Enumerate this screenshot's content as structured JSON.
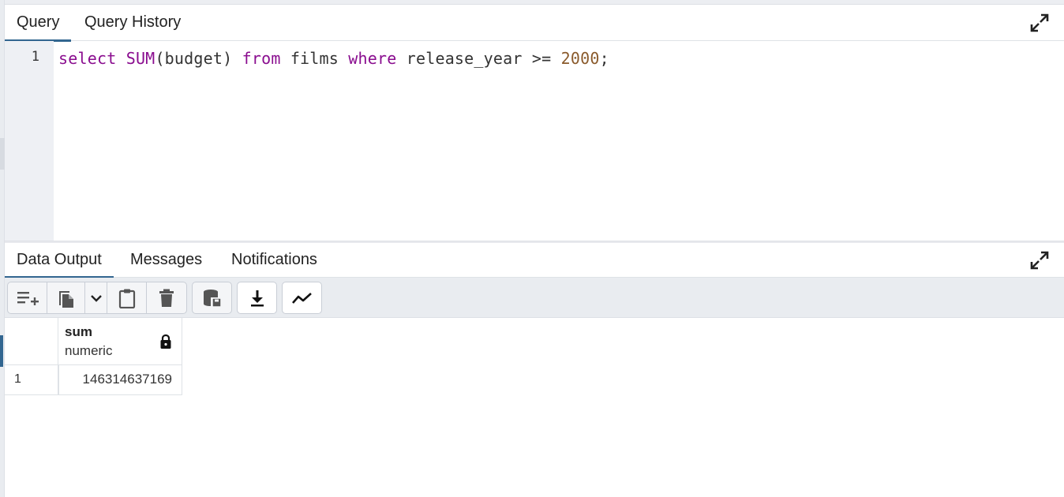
{
  "query_panel": {
    "tabs": [
      {
        "label": "Query",
        "active": true
      },
      {
        "label": "Query History",
        "active": false
      }
    ],
    "editor": {
      "line_number": "1",
      "sql_tokens": {
        "t1": "select",
        "t2": " ",
        "t3": "SUM",
        "t4": "(budget) ",
        "t5": "from",
        "t6": " films ",
        "t7": "where",
        "t8": " release_year >= ",
        "t9": "2000",
        "t10": ";"
      }
    }
  },
  "output_panel": {
    "tabs": [
      {
        "label": "Data Output",
        "active": true
      },
      {
        "label": "Messages",
        "active": false
      },
      {
        "label": "Notifications",
        "active": false
      }
    ],
    "toolbar": {
      "buttons": [
        "add-row-icon",
        "copy-icon",
        "chevron-down-icon",
        "paste-icon",
        "delete-icon",
        "save-data-icon",
        "download-icon",
        "graph-visualiser-icon"
      ]
    },
    "grid": {
      "columns": [
        {
          "name": "sum",
          "type": "numeric",
          "read_only": true
        }
      ],
      "rows": [
        {
          "row_number": "1",
          "values": [
            "146314637169"
          ]
        }
      ]
    }
  },
  "colors": {
    "accent": "#326690",
    "keyword": "#8a0d8f",
    "number": "#8a5a2b",
    "toolbar_bg": "#e9ecf0"
  }
}
